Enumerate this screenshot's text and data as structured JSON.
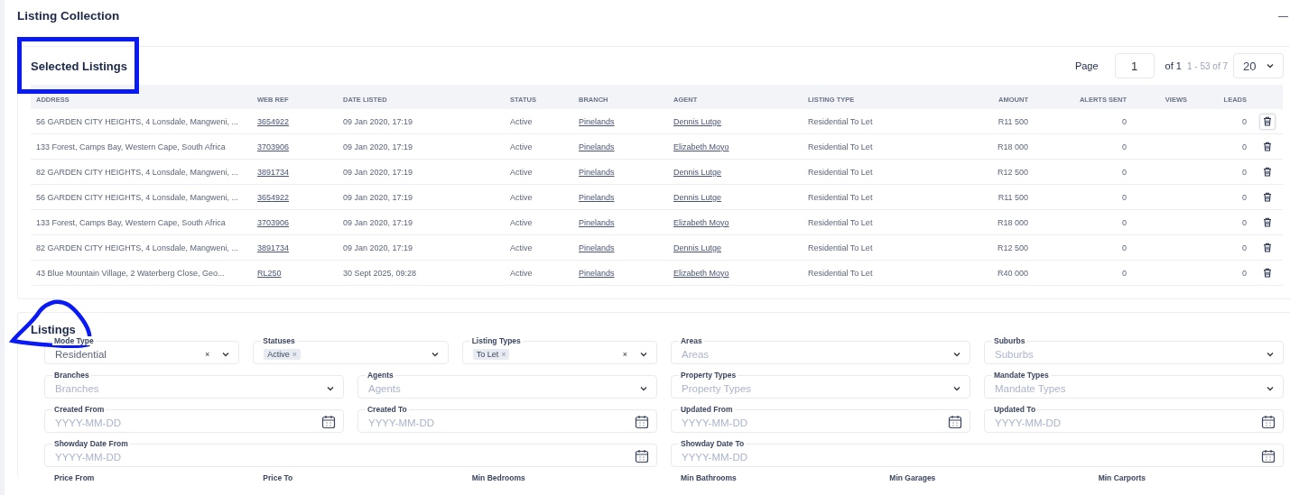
{
  "title": "Listing Collection",
  "collapse": "—",
  "selected": {
    "title": "Selected Listings",
    "pager": {
      "label": "Page",
      "page": "1",
      "of": "of 1",
      "range": "1 - 53 of 7",
      "size": "20"
    },
    "columns": [
      "ADDRESS",
      "WEB REF",
      "DATE LISTED",
      "STATUS",
      "BRANCH",
      "AGENT",
      "LISTING TYPE",
      "AMOUNT",
      "ALERTS SENT",
      "VIEWS",
      "LEADS"
    ],
    "rows": [
      {
        "address": "56 GARDEN CITY HEIGHTS, 4 Lonsdale, Mangweni, ...",
        "web_ref": "3654922",
        "date": "09 Jan 2020, 17:19",
        "status": "Active",
        "branch": "Pinelands",
        "agent": "Dennis Lutge",
        "type": "Residential To Let",
        "amount": "R11 500",
        "alerts": "0",
        "leads": "0",
        "highlighted": true
      },
      {
        "address": "133 Forest, Camps Bay, Western Cape, South Africa",
        "web_ref": "3703906",
        "date": "09 Jan 2020, 17:19",
        "status": "Active",
        "branch": "Pinelands",
        "agent": "Elizabeth Moyo",
        "type": "Residential To Let",
        "amount": "R18 000",
        "alerts": "0",
        "leads": "0",
        "highlighted": false
      },
      {
        "address": "82 GARDEN CITY HEIGHTS, 4 Lonsdale, Mangweni, ...",
        "web_ref": "3891734",
        "date": "09 Jan 2020, 17:19",
        "status": "Active",
        "branch": "Pinelands",
        "agent": "Dennis Lutge",
        "type": "Residential To Let",
        "amount": "R12 500",
        "alerts": "0",
        "leads": "0",
        "highlighted": false
      },
      {
        "address": "56 GARDEN CITY HEIGHTS, 4 Lonsdale, Mangweni, ...",
        "web_ref": "3654922",
        "date": "09 Jan 2020, 17:19",
        "status": "Active",
        "branch": "Pinelands",
        "agent": "Dennis Lutge",
        "type": "Residential To Let",
        "amount": "R11 500",
        "alerts": "0",
        "leads": "0",
        "highlighted": false
      },
      {
        "address": "133 Forest, Camps Bay, Western Cape, South Africa",
        "web_ref": "3703906",
        "date": "09 Jan 2020, 17:19",
        "status": "Active",
        "branch": "Pinelands",
        "agent": "Elizabeth Moyo",
        "type": "Residential To Let",
        "amount": "R18 000",
        "alerts": "0",
        "leads": "0",
        "highlighted": false
      },
      {
        "address": "82 GARDEN CITY HEIGHTS, 4 Lonsdale, Mangweni, ...",
        "web_ref": "3891734",
        "date": "09 Jan 2020, 17:19",
        "status": "Active",
        "branch": "Pinelands",
        "agent": "Dennis Lutge",
        "type": "Residential To Let",
        "amount": "R12 500",
        "alerts": "0",
        "leads": "0",
        "highlighted": false
      },
      {
        "address": "43 Blue Mountain Village, 2 Waterberg Close, Geo...",
        "web_ref": "RL250",
        "date": "30 Sept 2025, 09:28",
        "status": "Active",
        "branch": "Pinelands",
        "agent": "Elizabeth Moyo",
        "type": "Residential To Let",
        "amount": "R40 000",
        "alerts": "0",
        "leads": "0",
        "highlighted": false
      }
    ]
  },
  "listings": {
    "title": "Listings",
    "filter_rows": [
      [
        {
          "kind": "select",
          "label": "Mode Type",
          "value": "Residential",
          "clear": "×"
        },
        {
          "kind": "select",
          "label": "Statuses",
          "chips": [
            {
              "label": "Active",
              "remove": "×"
            }
          ]
        },
        {
          "kind": "select",
          "label": "Listing Types",
          "chips": [
            {
              "label": "To Let",
              "remove": "×"
            }
          ],
          "clear": "×"
        },
        {
          "kind": "select",
          "label": "Areas",
          "placeholder": "Areas"
        },
        {
          "kind": "select",
          "label": "Suburbs",
          "placeholder": "Suburbs"
        }
      ],
      [
        {
          "kind": "select",
          "label": "Branches",
          "placeholder": "Branches"
        },
        {
          "kind": "select",
          "label": "Agents",
          "placeholder": "Agents"
        },
        {
          "kind": "select",
          "label": "Property Types",
          "placeholder": "Property Types"
        },
        {
          "kind": "select",
          "label": "Mandate Types",
          "placeholder": "Mandate Types"
        }
      ],
      [
        {
          "kind": "date",
          "label": "Created From",
          "placeholder": "YYYY-MM-DD"
        },
        {
          "kind": "date",
          "label": "Created To",
          "placeholder": "YYYY-MM-DD"
        },
        {
          "kind": "date",
          "label": "Updated From",
          "placeholder": "YYYY-MM-DD"
        },
        {
          "kind": "date",
          "label": "Updated To",
          "placeholder": "YYYY-MM-DD"
        }
      ],
      [
        {
          "kind": "date",
          "label": "Showday Date From",
          "placeholder": "YYYY-MM-DD"
        },
        {
          "kind": "date",
          "label": "Showday Date To",
          "placeholder": "YYYY-MM-DD"
        }
      ],
      [
        {
          "kind": "number",
          "label": "Price From"
        },
        {
          "kind": "number",
          "label": "Price To"
        },
        {
          "kind": "number",
          "label": "Min Bedrooms"
        },
        {
          "kind": "number",
          "label": "Min Bathrooms"
        },
        {
          "kind": "number",
          "label": "Min Garages"
        },
        {
          "kind": "number",
          "label": "Min Carports"
        }
      ]
    ]
  }
}
